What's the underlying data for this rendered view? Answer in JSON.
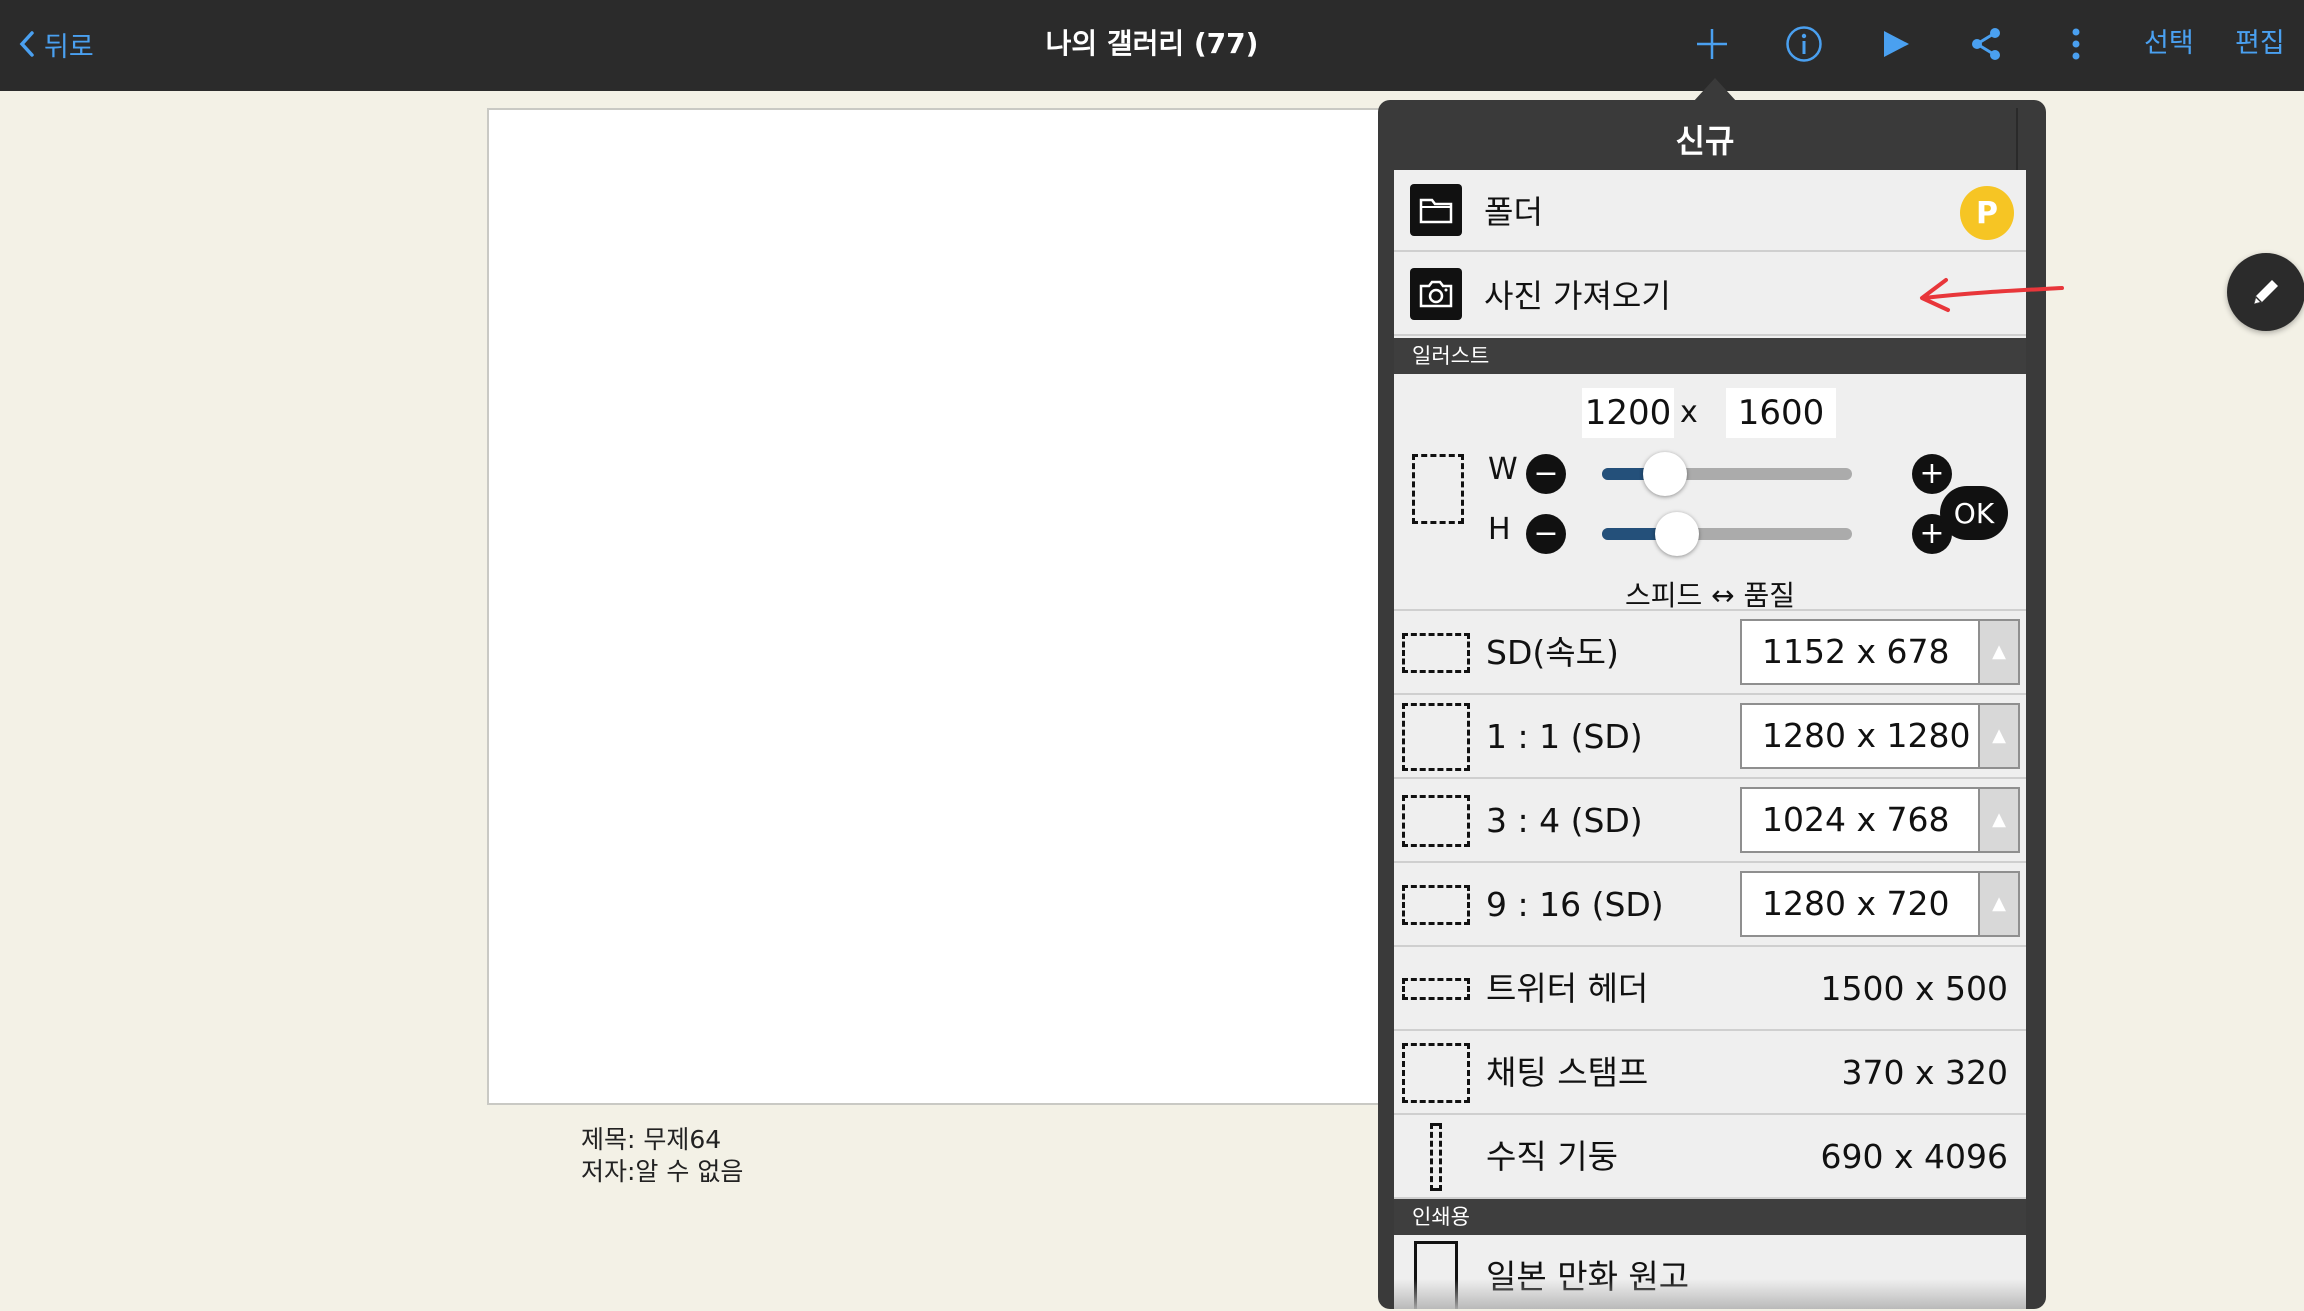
{
  "topbar": {
    "back_label": "뒤로",
    "title": "나의 갤러리 (77)",
    "select_label": "선택",
    "edit_label": "편집",
    "icons": [
      "plus-icon",
      "info-icon",
      "play-icon",
      "share-icon",
      "more-vertical-icon"
    ],
    "accent": "#4aa0f0"
  },
  "artwork": {
    "title_line": "제목: 무제64",
    "author_line": "저자:알 수 없음"
  },
  "popup": {
    "tab_title": "신규",
    "folder_label": "폴더",
    "premium_badge": "P",
    "import_label": "사진 가져오기",
    "section_illust": "일러스트",
    "custom": {
      "width": "1200",
      "times": "x",
      "height": "1600",
      "w_label": "W",
      "h_label": "H",
      "minus": "−",
      "plus": "+",
      "ok_label": "OK",
      "speed_quality": "스피드 ↔ 품질"
    },
    "presets": [
      {
        "name": "SD(속도)",
        "size": "1152 x 678",
        "dropdown": true
      },
      {
        "name": "1 : 1 (SD)",
        "size": "1280 x 1280",
        "dropdown": true
      },
      {
        "name": "3 : 4 (SD)",
        "size": "1024 x 768",
        "dropdown": true
      },
      {
        "name": "9 : 16 (SD)",
        "size": "1280 x 720",
        "dropdown": true
      },
      {
        "name": "트위터 헤더",
        "size": "1500 x 500",
        "dropdown": false
      },
      {
        "name": "채팅 스탬프",
        "size": "370 x 320",
        "dropdown": false
      },
      {
        "name": "수직 기둥",
        "size": "690 x 4096",
        "dropdown": false
      }
    ],
    "section_print": "인쇄용",
    "print_item": "일본 만화 원고",
    "spinner_arrow": "▲"
  }
}
